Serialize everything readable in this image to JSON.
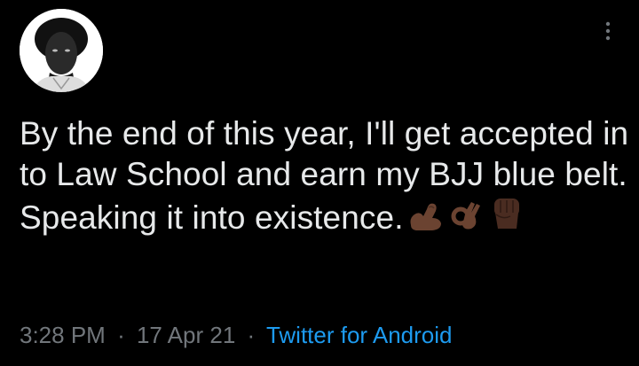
{
  "tweet": {
    "text": "By the end of this year, I'll get accepted in to Law School and earn my BJJ blue belt. Speaking it into existence.",
    "emojis": [
      "flexed-biceps-medium-dark",
      "ok-hand-medium-dark",
      "raised-fist-dark"
    ],
    "time": "3:28 PM",
    "separator": "·",
    "date": "17 Apr 21",
    "source": "Twitter for Android"
  },
  "icons": {
    "more": "vertical-ellipsis-icon",
    "avatar": "profile-avatar"
  },
  "colors": {
    "background": "#000000",
    "text": "#e7e9ea",
    "meta": "#71767b",
    "link": "#1d9bf0",
    "emoji_skin": "#6b4331"
  }
}
